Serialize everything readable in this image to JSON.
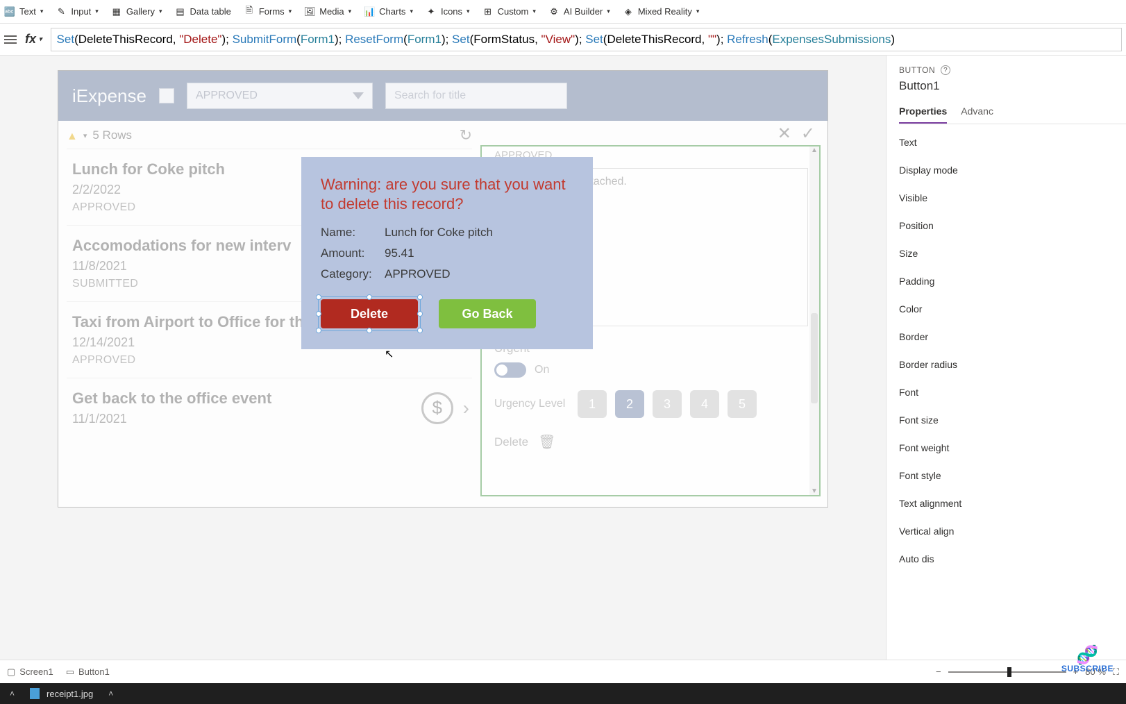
{
  "ribbon": {
    "items": [
      {
        "label": "Text"
      },
      {
        "label": "Input"
      },
      {
        "label": "Gallery"
      },
      {
        "label": "Data table"
      },
      {
        "label": "Forms"
      },
      {
        "label": "Media"
      },
      {
        "label": "Charts"
      },
      {
        "label": "Icons"
      },
      {
        "label": "Custom"
      },
      {
        "label": "AI Builder"
      },
      {
        "label": "Mixed Reality"
      }
    ]
  },
  "formula_bar": {
    "fx": "fx",
    "tokens": [
      {
        "t": "Set",
        "c": "fn"
      },
      {
        "t": "(DeleteThisRecord, ",
        "c": "pl"
      },
      {
        "t": "\"Delete\"",
        "c": "str"
      },
      {
        "t": "); ",
        "c": "pl"
      },
      {
        "t": "SubmitForm",
        "c": "fn"
      },
      {
        "t": "(",
        "c": "pl"
      },
      {
        "t": "Form1",
        "c": "id"
      },
      {
        "t": "); ",
        "c": "pl"
      },
      {
        "t": "ResetForm",
        "c": "fn"
      },
      {
        "t": "(",
        "c": "pl"
      },
      {
        "t": "Form1",
        "c": "id"
      },
      {
        "t": "); ",
        "c": "pl"
      },
      {
        "t": "Set",
        "c": "fn"
      },
      {
        "t": "(FormStatus, ",
        "c": "pl"
      },
      {
        "t": "\"View\"",
        "c": "str"
      },
      {
        "t": "); ",
        "c": "pl"
      },
      {
        "t": "Set",
        "c": "fn"
      },
      {
        "t": "(DeleteThisRecord, ",
        "c": "pl"
      },
      {
        "t": "\"\"",
        "c": "str"
      },
      {
        "t": "); ",
        "c": "pl"
      },
      {
        "t": "Refresh",
        "c": "fn"
      },
      {
        "t": "(",
        "c": "pl"
      },
      {
        "t": "ExpensesSubmissions",
        "c": "id"
      },
      {
        "t": ")",
        "c": "pl"
      }
    ]
  },
  "breadcrumb": {
    "screen": "Screen1",
    "control": "Button1"
  },
  "zoom": {
    "value": "80",
    "unit": "%"
  },
  "taskbar": {
    "file": "receipt1.jpg"
  },
  "app": {
    "title": "iExpense",
    "dropdown_value": "APPROVED",
    "search_placeholder": "Search for title",
    "rows_label": "5 Rows",
    "list": [
      {
        "title": "Lunch for Coke pitch",
        "date": "2/2/2022",
        "status": "APPROVED",
        "kind": "plain"
      },
      {
        "title": "Accomodations for new interv",
        "date": "11/8/2021",
        "status": "SUBMITTED",
        "kind": "plain"
      },
      {
        "title": "Taxi from Airport to Office for the festival",
        "date": "12/14/2021",
        "status": "APPROVED",
        "kind": "check"
      },
      {
        "title": "Get back to the office event",
        "date": "11/1/2021",
        "status": "",
        "kind": "dollar"
      }
    ],
    "form": {
      "approved": "APPROVED",
      "attached_text": "attached.",
      "urgent_label": "Urgent",
      "toggle_text": "On",
      "urgency_level_label": "Urgency Level",
      "levels": [
        "1",
        "2",
        "3",
        "4",
        "5"
      ],
      "selected_level": "2",
      "delete_label": "Delete"
    }
  },
  "modal": {
    "warning": "Warning: are you sure that you want to delete this record?",
    "name_label": "Name:",
    "name_value": "Lunch for Coke pitch",
    "amount_label": "Amount:",
    "amount_value": "95.41",
    "category_label": "Category:",
    "category_value": "APPROVED",
    "delete_btn": "Delete",
    "goback_btn": "Go Back"
  },
  "right_pane": {
    "type": "BUTTON",
    "name": "Button1",
    "tabs": [
      "Properties",
      "Advanc"
    ],
    "props": [
      "Text",
      "Display mode",
      "Visible",
      "Position",
      "Size",
      "Padding",
      "Color",
      "Border",
      "Border radius",
      "Font",
      "Font size",
      "Font weight",
      "Font style",
      "Text alignment",
      "Vertical align",
      "Auto dis"
    ]
  },
  "subscribe": "SUBSCRIBE"
}
